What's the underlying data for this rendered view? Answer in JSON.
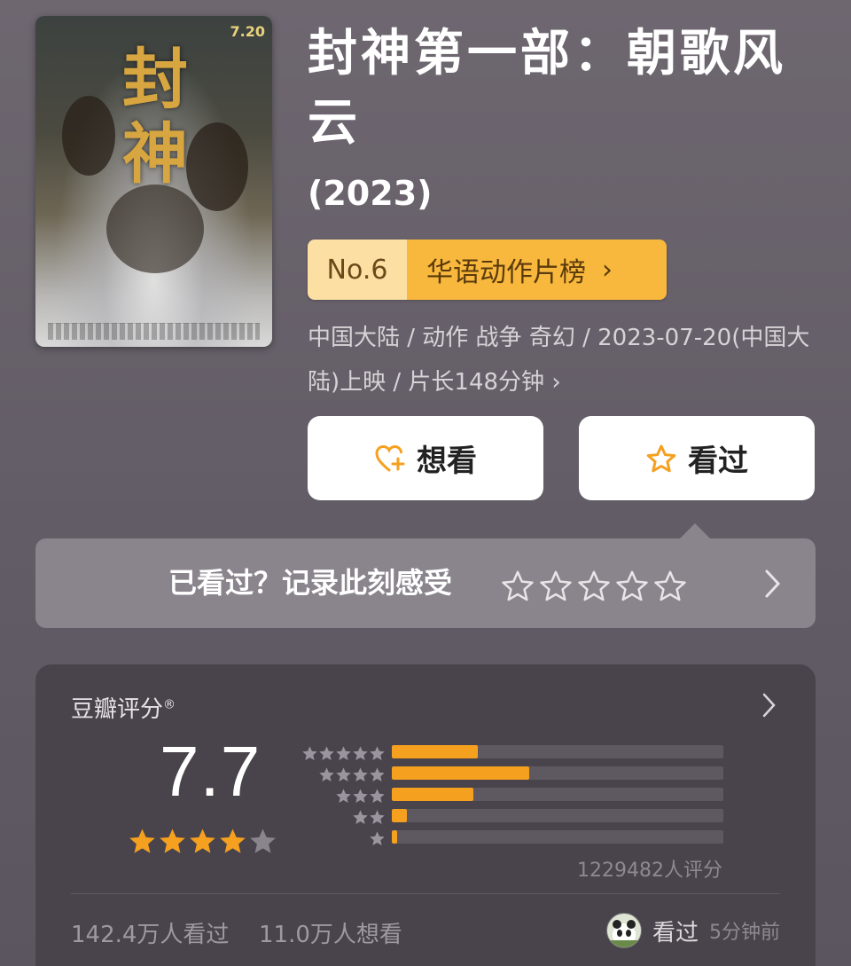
{
  "movie": {
    "title": "封神第一部：朝歌风云",
    "year": "(2023)",
    "poster": {
      "glyph": "封神",
      "date_badge": "7.20"
    },
    "rank": {
      "number": "No.6",
      "list": "华语动作片榜",
      "arrow": "›"
    },
    "meta": "中国大陆 / 动作 战争 奇幻 / 2023-07-20(中国大陆)上映 / 片长148分钟 ›"
  },
  "actions": {
    "want_label": "想看",
    "seen_label": "看过"
  },
  "record": {
    "prompt": "已看过？记录此刻感受",
    "star_count": 5
  },
  "rating": {
    "label": "豆瓣评分",
    "registered": "®",
    "score": "7.7",
    "stars_filled": 4,
    "stars_total": 5,
    "distribution": [
      {
        "stars": 5,
        "fraction": 0.26
      },
      {
        "stars": 4,
        "fraction": 0.415
      },
      {
        "stars": 3,
        "fraction": 0.245
      },
      {
        "stars": 2,
        "fraction": 0.045
      },
      {
        "stars": 1,
        "fraction": 0.015
      }
    ],
    "count_text": "1229482人评分",
    "watched_text": "142.4万人看过",
    "want_text": "11.0万人想看",
    "my_status": "看过",
    "my_time": "5分钟前"
  },
  "colors": {
    "accent": "#f6a01f",
    "rank_light": "#fce0a3",
    "rank_dark": "#f8b83d",
    "panel": "#49444b"
  }
}
